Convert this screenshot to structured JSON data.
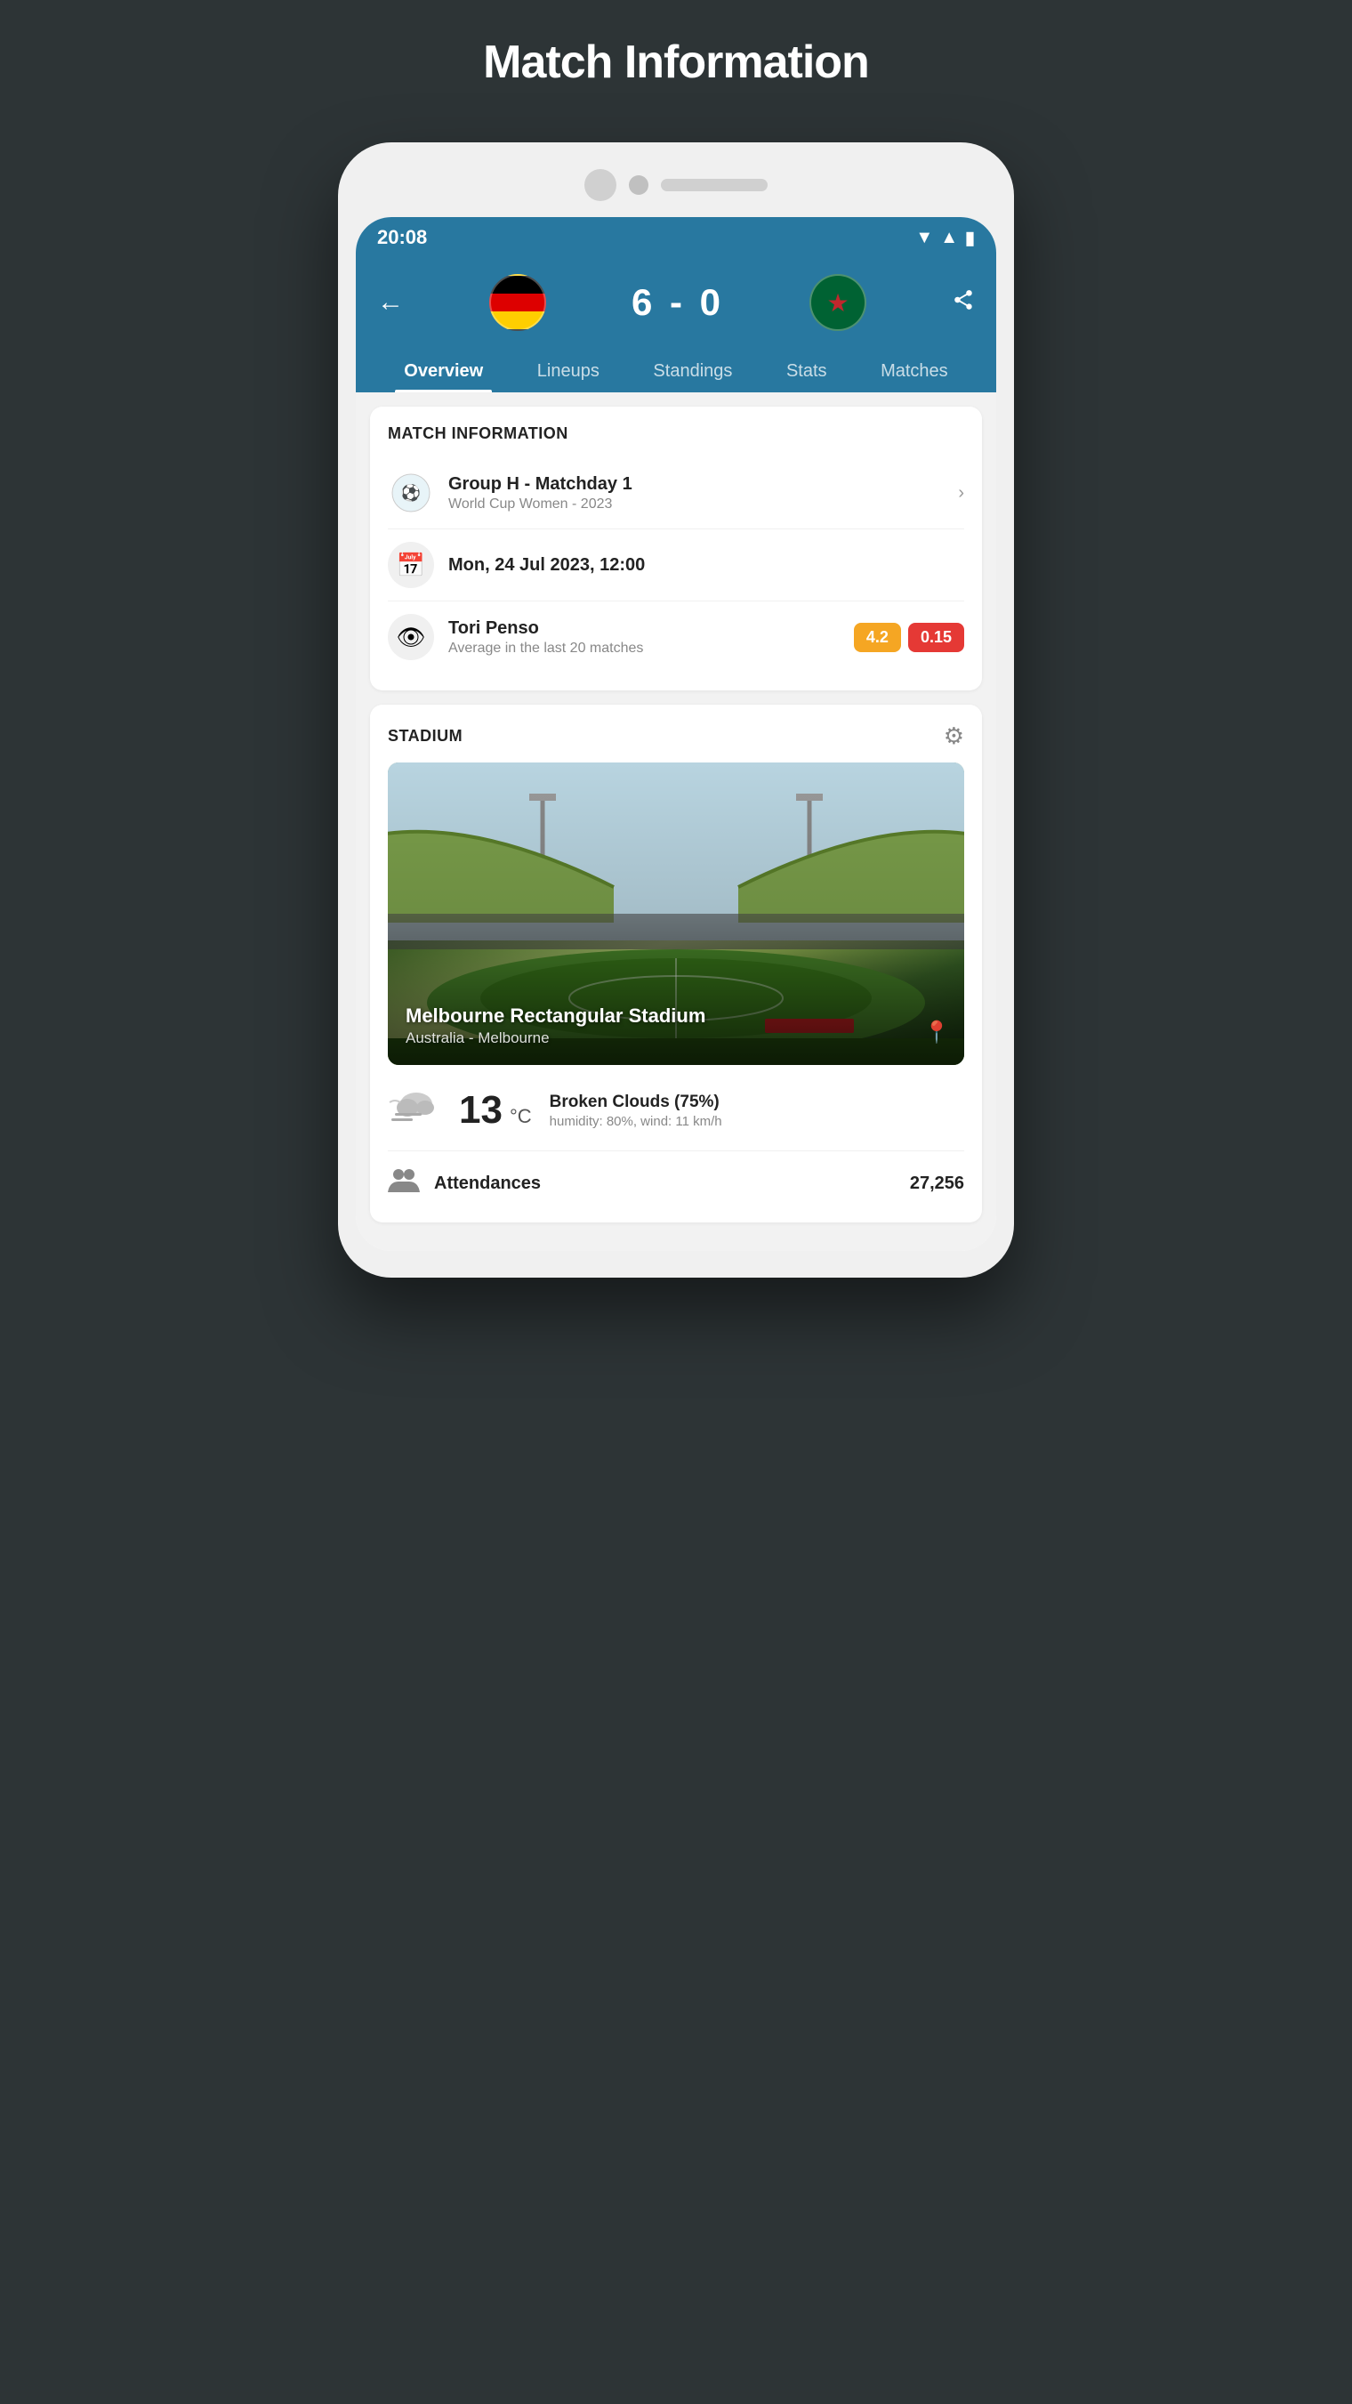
{
  "page": {
    "title": "Match Information"
  },
  "status_bar": {
    "time": "20:08"
  },
  "header": {
    "back_label": "←",
    "score": "6 - 0",
    "share_label": "⤢",
    "team1_flag": "Germany",
    "team2_flag": "Morocco"
  },
  "tabs": [
    {
      "label": "Overview",
      "active": true
    },
    {
      "label": "Lineups",
      "active": false
    },
    {
      "label": "Standings",
      "active": false
    },
    {
      "label": "Stats",
      "active": false
    },
    {
      "label": "Matches",
      "active": false
    }
  ],
  "match_info_card": {
    "title": "MATCH INFORMATION",
    "competition": {
      "primary": "Group H - Matchday 1",
      "secondary": "World Cup Women - 2023"
    },
    "date": {
      "value": "Mon, 24 Jul 2023, 12:00"
    },
    "referee": {
      "name": "Tori Penso",
      "subtitle": "Average in the last 20 matches",
      "badge1": "4.2",
      "badge2": "0.15"
    }
  },
  "stadium_card": {
    "title": "STADIUM",
    "name": "Melbourne Rectangular Stadium",
    "location": "Australia - Melbourne"
  },
  "weather": {
    "temperature": "13",
    "unit": "°C",
    "description": "Broken Clouds (75%)",
    "details": "humidity: 80%, wind: 11 km/h"
  },
  "attendance": {
    "label": "Attendances",
    "value": "27,256"
  }
}
